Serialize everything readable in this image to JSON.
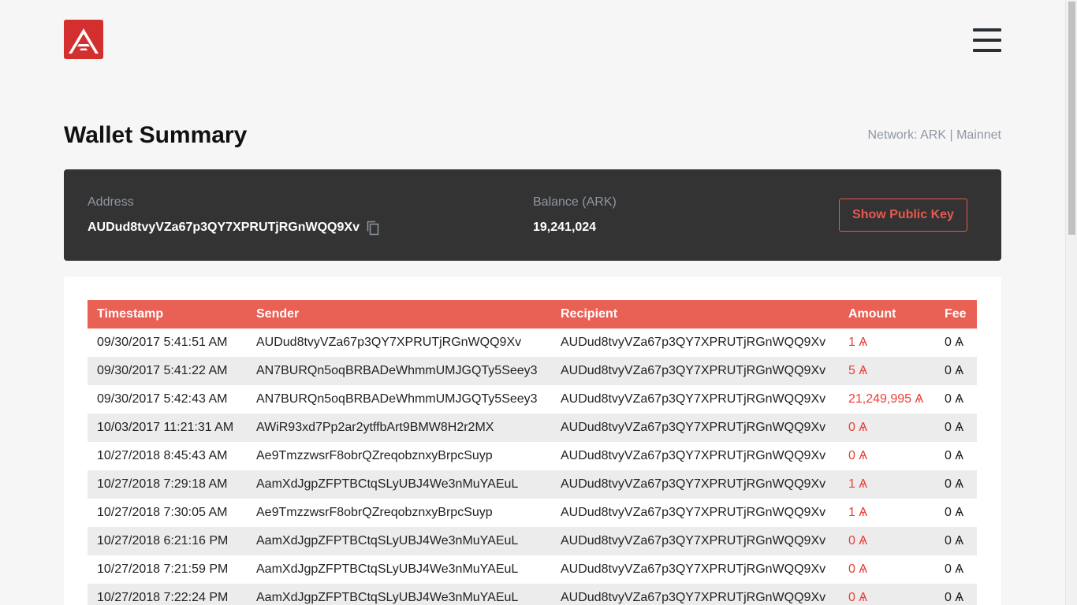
{
  "header": {
    "logo_icon": "ark-logo-icon",
    "menu_icon": "hamburger-menu-icon",
    "brand_color": "#d32f2f"
  },
  "page": {
    "title": "Wallet Summary",
    "network": "Network: ARK | Mainnet"
  },
  "summary": {
    "address_label": "Address",
    "address_value": "AUDud8tvyVZa67p3QY7XPRUTjRGnWQQ9Xv",
    "balance_label": "Balance (ARK)",
    "balance_value": "19,241,024",
    "show_public_key_label": "Show Public Key",
    "copy_icon": "copy-icon"
  },
  "table": {
    "columns": [
      "Timestamp",
      "Sender",
      "Recipient",
      "Amount",
      "Fee"
    ],
    "rows": [
      {
        "timestamp": "09/30/2017 5:41:51 AM",
        "sender": "AUDud8tvyVZa67p3QY7XPRUTjRGnWQQ9Xv",
        "recipient": "AUDud8tvyVZa67p3QY7XPRUTjRGnWQQ9Xv",
        "amount": "1 Ѧ",
        "fee": "0 Ѧ"
      },
      {
        "timestamp": "09/30/2017 5:41:22 AM",
        "sender": "AN7BURQn5oqBRBADeWhmmUMJGQTy5Seey3",
        "recipient": "AUDud8tvyVZa67p3QY7XPRUTjRGnWQQ9Xv",
        "amount": "5 Ѧ",
        "fee": "0 Ѧ"
      },
      {
        "timestamp": "09/30/2017 5:42:43 AM",
        "sender": "AN7BURQn5oqBRBADeWhmmUMJGQTy5Seey3",
        "recipient": "AUDud8tvyVZa67p3QY7XPRUTjRGnWQQ9Xv",
        "amount": "21,249,995 Ѧ",
        "fee": "0 Ѧ"
      },
      {
        "timestamp": "10/03/2017 11:21:31 AM",
        "sender": "AWiR93xd7Pp2ar2ytffbArt9BMW8H2r2MX",
        "recipient": "AUDud8tvyVZa67p3QY7XPRUTjRGnWQQ9Xv",
        "amount": "0 Ѧ",
        "fee": "0 Ѧ"
      },
      {
        "timestamp": "10/27/2018 8:45:43 AM",
        "sender": "Ae9TmzzwsrF8obrQZreqobznxyBrpcSuyp",
        "recipient": "AUDud8tvyVZa67p3QY7XPRUTjRGnWQQ9Xv",
        "amount": "0 Ѧ",
        "fee": "0 Ѧ"
      },
      {
        "timestamp": "10/27/2018 7:29:18 AM",
        "sender": "AamXdJgpZFPTBCtqSLyUBJ4We3nMuYAEuL",
        "recipient": "AUDud8tvyVZa67p3QY7XPRUTjRGnWQQ9Xv",
        "amount": "1 Ѧ",
        "fee": "0 Ѧ"
      },
      {
        "timestamp": "10/27/2018 7:30:05 AM",
        "sender": "Ae9TmzzwsrF8obrQZreqobznxyBrpcSuyp",
        "recipient": "AUDud8tvyVZa67p3QY7XPRUTjRGnWQQ9Xv",
        "amount": "1 Ѧ",
        "fee": "0 Ѧ"
      },
      {
        "timestamp": "10/27/2018 6:21:16 PM",
        "sender": "AamXdJgpZFPTBCtqSLyUBJ4We3nMuYAEuL",
        "recipient": "AUDud8tvyVZa67p3QY7XPRUTjRGnWQQ9Xv",
        "amount": "0 Ѧ",
        "fee": "0 Ѧ"
      },
      {
        "timestamp": "10/27/2018 7:21:59 PM",
        "sender": "AamXdJgpZFPTBCtqSLyUBJ4We3nMuYAEuL",
        "recipient": "AUDud8tvyVZa67p3QY7XPRUTjRGnWQQ9Xv",
        "amount": "0 Ѧ",
        "fee": "0 Ѧ"
      },
      {
        "timestamp": "10/27/2018 7:22:24 PM",
        "sender": "AamXdJgpZFPTBCtqSLyUBJ4We3nMuYAEuL",
        "recipient": "AUDud8tvyVZa67p3QY7XPRUTjRGnWQQ9Xv",
        "amount": "0 Ѧ",
        "fee": "0 Ѧ"
      }
    ]
  },
  "colors": {
    "accent": "#e96055",
    "amount": "#e8413a",
    "panel": "#333333"
  }
}
